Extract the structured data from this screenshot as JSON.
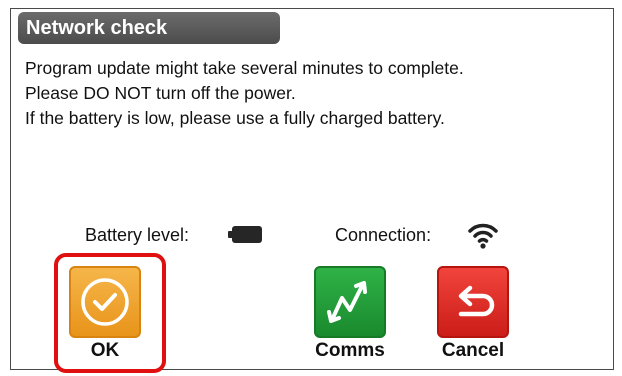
{
  "dialog": {
    "title": "Network check",
    "message_lines": [
      "Program update might take several minutes to complete.",
      "Please DO NOT turn off the power.",
      "If the battery is low, please use a fully charged battery."
    ]
  },
  "status": {
    "battery_label": "Battery level:",
    "battery_icon": "battery-icon",
    "connection_label": "Connection:",
    "connection_icon": "wifi-icon"
  },
  "buttons": {
    "ok": {
      "label": "OK",
      "icon": "checkmark-circle-icon",
      "color": "#f0a232",
      "selected": true
    },
    "comms": {
      "label": "Comms",
      "icon": "signal-arrows-icon",
      "color": "#24a03b"
    },
    "cancel": {
      "label": "Cancel",
      "icon": "return-arrow-icon",
      "color": "#e0302a"
    }
  },
  "colors": {
    "title_bar": "#5a5a5a",
    "focus_ring": "#e01010"
  }
}
